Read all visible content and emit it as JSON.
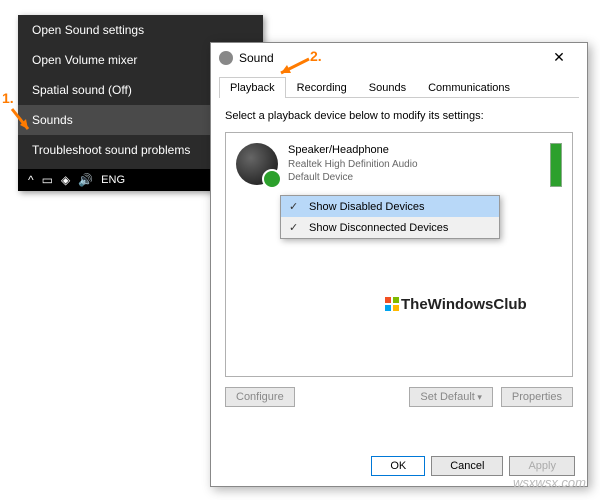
{
  "annotations": {
    "step1": "1.",
    "step2": "2."
  },
  "context_menu": {
    "items": [
      "Open Sound settings",
      "Open Volume mixer",
      "Spatial sound (Off)",
      "Sounds",
      "Troubleshoot sound problems"
    ],
    "hover_index": 3
  },
  "taskbar": {
    "lang": "ENG"
  },
  "dialog": {
    "title": "Sound",
    "tabs": [
      "Playback",
      "Recording",
      "Sounds",
      "Communications"
    ],
    "active_tab": 0,
    "instruction": "Select a playback device below to modify its settings:",
    "device": {
      "name": "Speaker/Headphone",
      "driver": "Realtek High Definition Audio",
      "status": "Default Device"
    },
    "popup": {
      "items": [
        "Show Disabled Devices",
        "Show Disconnected Devices"
      ],
      "selected_index": 0
    },
    "buttons": {
      "configure": "Configure",
      "set_default": "Set Default",
      "properties": "Properties",
      "ok": "OK",
      "cancel": "Cancel",
      "apply": "Apply"
    }
  },
  "watermarks": {
    "site1": "TheWindowsClub",
    "site2": "wsxwsx.com"
  }
}
